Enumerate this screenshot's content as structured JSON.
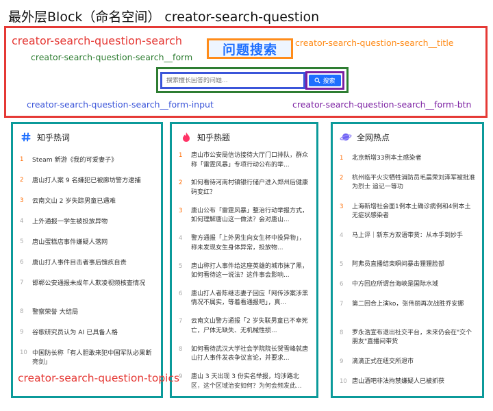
{
  "page": {
    "title": "最外层Block（命名空间） creator-search-question"
  },
  "search_block": {
    "label": "creator-search-question-search",
    "form_label": "creator-search-question-search__form",
    "title_label": "creator-search-question-search__title",
    "title_text": "问题搜索",
    "input_label": "creator-search-question-search__form-input",
    "input_placeholder": "搜索擅长回答的问题...",
    "btn_label": "creator-search-question-search__form-btn",
    "btn_text": "搜索",
    "btn_icon": "search-icon"
  },
  "topics_label": "creator-search-question-topics",
  "columns": [
    {
      "title": "知乎热词",
      "icon": "hash-icon",
      "items": [
        {
          "n": "1",
          "text": "Steam 新游《我的可爱妻子》"
        },
        {
          "n": "2",
          "text": "唐山打人案 9 名嫌犯已被廊坊警方逮捕"
        },
        {
          "n": "3",
          "text": "云南文山 2 岁失踪男童已遇难"
        },
        {
          "n": "4",
          "text": "上外通报一学生被投放异物"
        },
        {
          "n": "5",
          "text": "唐山蛋糕店事件嫌疑人落网"
        },
        {
          "n": "6",
          "text": "唐山打人事件目击者事后愧疚自责"
        },
        {
          "n": "7",
          "text": "邯郸公安通报未成年人欺凌视频核查情况"
        },
        {
          "n": "8",
          "text": "警察荣誉 大结局"
        },
        {
          "n": "9",
          "text": "谷歌研究员认为 AI 已具备人格"
        },
        {
          "n": "10",
          "text": "中国防长称「有人胆敢来犯中国军队必果断亮剑」"
        }
      ]
    },
    {
      "title": "知乎热题",
      "icon": "flame-icon",
      "items": [
        {
          "n": "1",
          "text": "唐山市公安局信访接待大厅门口排队，群众称「雷霆风暴」专项行动公布的举..."
        },
        {
          "n": "2",
          "text": "如何看待河南村镇银行储户进入郑州后健康码变红？"
        },
        {
          "n": "3",
          "text": "唐山公布「雷霆风暴」整治行动举报方式，如何理解唐山这一做法？会对唐山..."
        },
        {
          "n": "4",
          "text": "警方通报「上外男生向女生杯中投异物」，称未发现女生身体异常，投放物..."
        },
        {
          "n": "5",
          "text": "唐山称打人事件给这座英雄的城市抹了黑，如何看待这一说法？这件事会影响..."
        },
        {
          "n": "6",
          "text": "唐山打人者陈继志妻子回应「网传涉案涉黑情况不属实，等着看通报吧」，真..."
        },
        {
          "n": "7",
          "text": "云南文山警方通报「2 岁失联男童已不幸死亡，尸体无缺失、无机械性损..."
        },
        {
          "n": "8",
          "text": "如何看待武汉大学社会学院院长贺雪峰就唐山打人事件发表争议言论，并要求..."
        },
        {
          "n": "9",
          "text": "唐山 3 天出现 3 份实名举报，均涉路北区，这个区域治安如何？为何会频发此..."
        }
      ]
    },
    {
      "title": "全网热点",
      "icon": "planet-icon",
      "items": [
        {
          "n": "1",
          "text": "北京新增33例本土感染者"
        },
        {
          "n": "2",
          "text": "杭州临平火灾牺牲消防员毛晨荣刘泽军被批准为烈士 追记一等功"
        },
        {
          "n": "3",
          "text": "上海新增社会面1例本土确诊病例和4例本土无症状感染者"
        },
        {
          "n": "4",
          "text": "马上评｜新东方双语带货：从本手到妙手"
        },
        {
          "n": "5",
          "text": "阿弗员直播结束瞬间暴击狸狸脸部"
        },
        {
          "n": "6",
          "text": "中方回应所谓台海峡是国际水域"
        },
        {
          "n": "7",
          "text": "第二回合上演ko，张伟丽再次战胜乔安娜"
        },
        {
          "n": "8",
          "text": "罗永浩宣布退出社交平台，未来仍会在\"交个朋友\"直播间带货"
        },
        {
          "n": "9",
          "text": "滴滴正式在纽交所退市"
        },
        {
          "n": "10",
          "text": "唐山酒吧非法拘禁嫌疑人已被抓获"
        }
      ]
    }
  ]
}
